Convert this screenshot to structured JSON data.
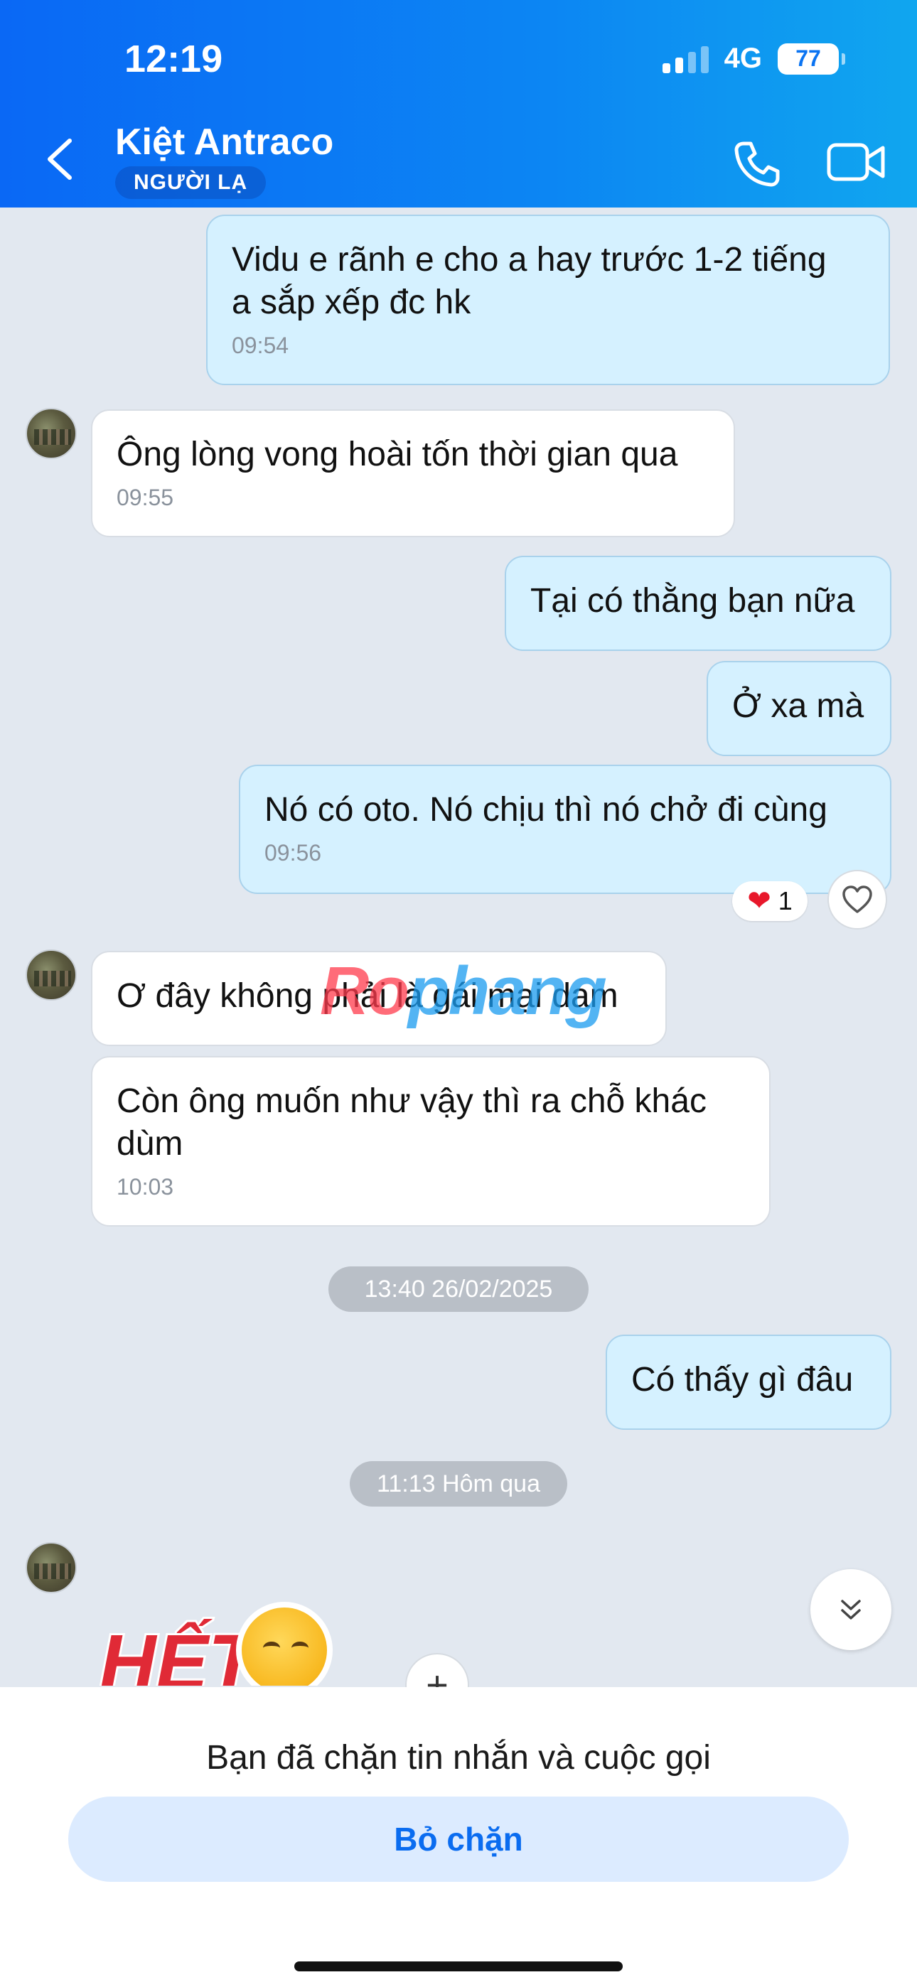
{
  "status_bar": {
    "time": "12:19",
    "network": "4G",
    "battery": "77"
  },
  "header": {
    "contact_name": "Kiệt Antraco",
    "badge": "NGƯỜI LẠ"
  },
  "messages": [
    {
      "side": "out",
      "text": "Vidu e rãnh e cho a hay trước 1-2 tiếng\na sắp xếp đc hk",
      "time": "09:54"
    },
    {
      "side": "in",
      "text": "Ông lòng vong hoài tốn thời gian qua",
      "time": "09:55"
    },
    {
      "side": "out",
      "text": "Tại có thằng bạn nữa",
      "time": ""
    },
    {
      "side": "out",
      "text": "Ở xa mà",
      "time": ""
    },
    {
      "side": "out",
      "text": "Nó có oto. Nó chịu thì nó chở đi cùng",
      "time": "09:56"
    },
    {
      "side": "in",
      "text": "Ơ đây không phải là gái mại dam",
      "time": ""
    },
    {
      "side": "in",
      "text": "Còn ông muốn như vậy thì ra chỗ khác\ndùm",
      "time": "10:03"
    },
    {
      "side": "out",
      "text": "Có thấy gì đâu",
      "time": ""
    }
  ],
  "reaction": {
    "count": "1"
  },
  "date_separators": [
    "13:40 26/02/2025",
    "11:13 Hôm qua"
  ],
  "watermark": {
    "part1": "Ro",
    "part2": "phang"
  },
  "sticker": {
    "text": "HẾT"
  },
  "bottom": {
    "blocked_notice": "Bạn đã chặn tin nhắn và cuộc gọi",
    "unblock_label": "Bỏ chặn"
  },
  "colors": {
    "header_start": "#0a68f5",
    "header_end": "#10a6ef",
    "outgoing_bubble": "#d5f1ff",
    "incoming_bubble": "#ffffff",
    "chat_background": "#e2e8f0",
    "accent": "#0a6cf0"
  }
}
